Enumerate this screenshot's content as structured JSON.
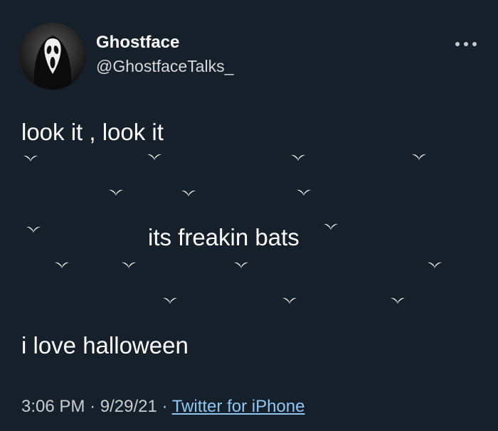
{
  "author": {
    "display_name": "Ghostface",
    "handle": "@GhostfaceTalks_",
    "avatar_icon": "ghostface-mask-icon"
  },
  "more_icon": "more-options-icon",
  "tweet": {
    "line1": "look it , look it",
    "line2": "its freakin bats",
    "line3": "i love halloween",
    "bat_icon": "bat-icon"
  },
  "meta": {
    "time": "3:06 PM",
    "separator": "·",
    "date": "9/29/21",
    "source": "Twitter for iPhone"
  },
  "colors": {
    "background": "#15202b",
    "text": "#ffffff",
    "secondary_text": "#c9ccd0",
    "link": "#8fc7f2"
  }
}
